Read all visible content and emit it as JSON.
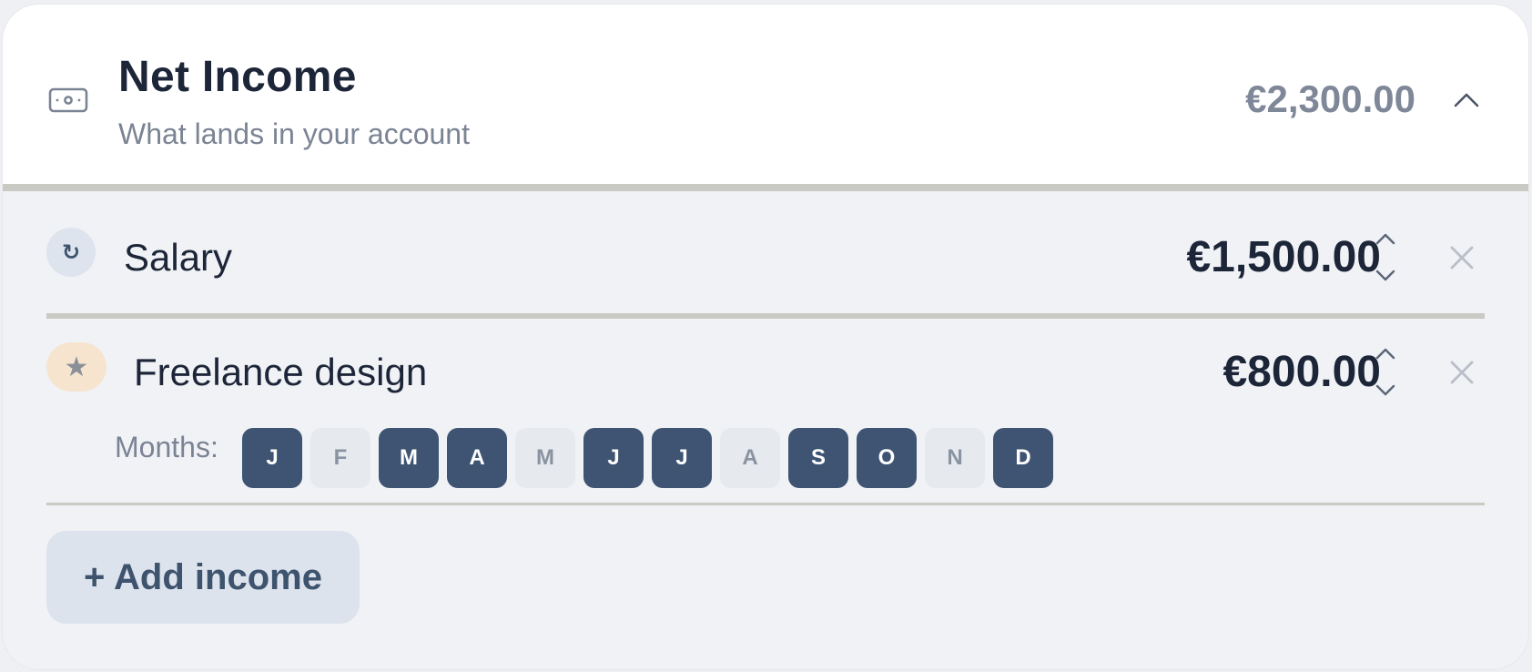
{
  "section": {
    "title": "Net Income",
    "subtitle": "What lands in your account",
    "total": "€2,300.00",
    "icon": "banknote-icon",
    "collapse_icon": "chevron-up-icon"
  },
  "items": [
    {
      "name": "Salary",
      "amount": "€1,500.00",
      "badge_icon": "recurring-icon",
      "badge_glyph": "↻"
    },
    {
      "name": "Freelance design",
      "amount": "€800.00",
      "badge_icon": "star-icon",
      "badge_glyph": "★",
      "months_label": "Months:",
      "months": [
        {
          "label": "J",
          "selected": true
        },
        {
          "label": "F",
          "selected": false
        },
        {
          "label": "M",
          "selected": true
        },
        {
          "label": "A",
          "selected": true
        },
        {
          "label": "M",
          "selected": false
        },
        {
          "label": "J",
          "selected": true
        },
        {
          "label": "J",
          "selected": true
        },
        {
          "label": "A",
          "selected": false
        },
        {
          "label": "S",
          "selected": true
        },
        {
          "label": "O",
          "selected": true
        },
        {
          "label": "N",
          "selected": false
        },
        {
          "label": "D",
          "selected": true
        }
      ]
    }
  ],
  "add_button": {
    "label": "+ Add income"
  },
  "colors": {
    "accent": "#3e5472",
    "text": "#1d2638",
    "muted": "#7b8494",
    "divider": "#c9cac4"
  }
}
